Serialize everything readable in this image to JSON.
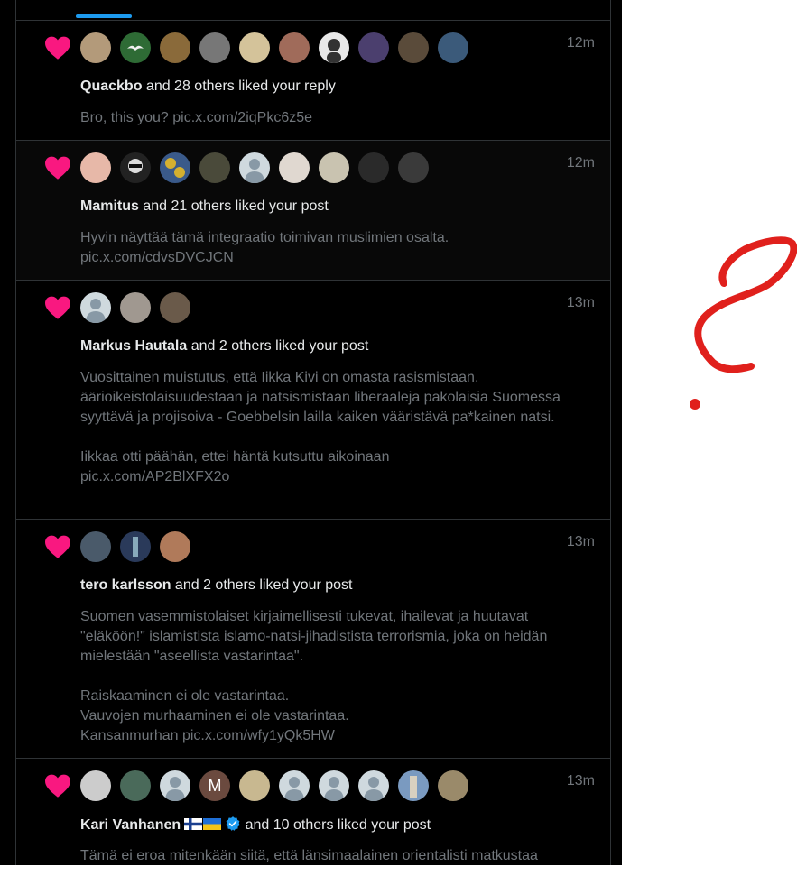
{
  "notifications": [
    {
      "time": "12m",
      "user": "Quackbo",
      "action": " and 28 others liked your reply",
      "text": "Bro, this you? pic.x.com/2iqPkc6z5e",
      "avatar_colors": [
        "#b39a7a",
        "#2e6b35",
        "#8a6a3a",
        "#777777",
        "#d4c39a",
        "#a06b5a",
        "#e8e8e8",
        "#4b3f6e",
        "#5a4b3a",
        "#3b5a7a"
      ]
    },
    {
      "time": "12m",
      "user": "Mamitus",
      "action": " and 21 others liked your post",
      "text": "Hyvin näyttää tämä integraatio toimivan muslimien osalta.\npic.x.com/cdvsDVCJCN",
      "avatar_colors": [
        "#e7b8a8",
        "#222222",
        "#3a5a8a",
        "#4a4a3a",
        "#cfd9de",
        "#e0d8d0",
        "#c9c3b0",
        "#2a2a2a",
        "#3a3a3a"
      ]
    },
    {
      "time": "13m",
      "user": "Markus Hautala",
      "action": " and 2 others liked your post",
      "text": "Vuosittainen muistutus, että Iikka Kivi on omasta rasismistaan, äärioikeistolaisuudestaan ja natsismistaan liberaaleja pakolaisia Suomessa syyttävä ja projisoiva - Goebbelsin lailla kaiken vääristävä pa*kainen natsi.\n\nIikkaa otti päähän, ettei häntä kutsuttu aikoinaan\npic.x.com/AP2BlXFX2o",
      "avatar_colors": [
        "#cfd9de",
        "#a09890",
        "#6a5a4a"
      ]
    },
    {
      "time": "13m",
      "user": "tero karlsson",
      "action": " and 2 others liked your post",
      "text": "Suomen vasemmistolaiset kirjaimellisesti tukevat, ihailevat ja huutavat \"eläköön!\" islamistista islamo-natsi-jihadistista terrorismia, joka on heidän mielestään \"aseellista vastarintaa\".\n\nRaiskaaminen ei ole vastarintaa.\nVauvojen murhaaminen ei ole vastarintaa.\nKansanmurhan pic.x.com/wfy1yQk5HW",
      "avatar_colors": [
        "#4a5a6a",
        "#2a3a5a",
        "#b07a5a"
      ]
    },
    {
      "time": "13m",
      "user": "Kari Vanhanen",
      "action": " and 10 others liked your post",
      "text": "Tämä ei eroa mitenkään siitä, että länsimaalainen orientalisti matkustaa",
      "avatar_letter": "M",
      "avatar_colors": [
        "#cccccc",
        "#4a6a5a",
        "#cfd9de",
        "#6b4a3f",
        "#c8b890",
        "#cfd9de",
        "#cfd9de",
        "#cfd9de",
        "#7a9ac0",
        "#9a8a6a"
      ]
    }
  ],
  "colors": {
    "heart": "#f91880",
    "accent": "#1d9bf0",
    "annotation": "#e0201c"
  },
  "icons": [
    "heart-icon",
    "default-avatar-icon",
    "verified-badge-icon",
    "finland-flag-icon",
    "ukraine-flag-icon"
  ]
}
